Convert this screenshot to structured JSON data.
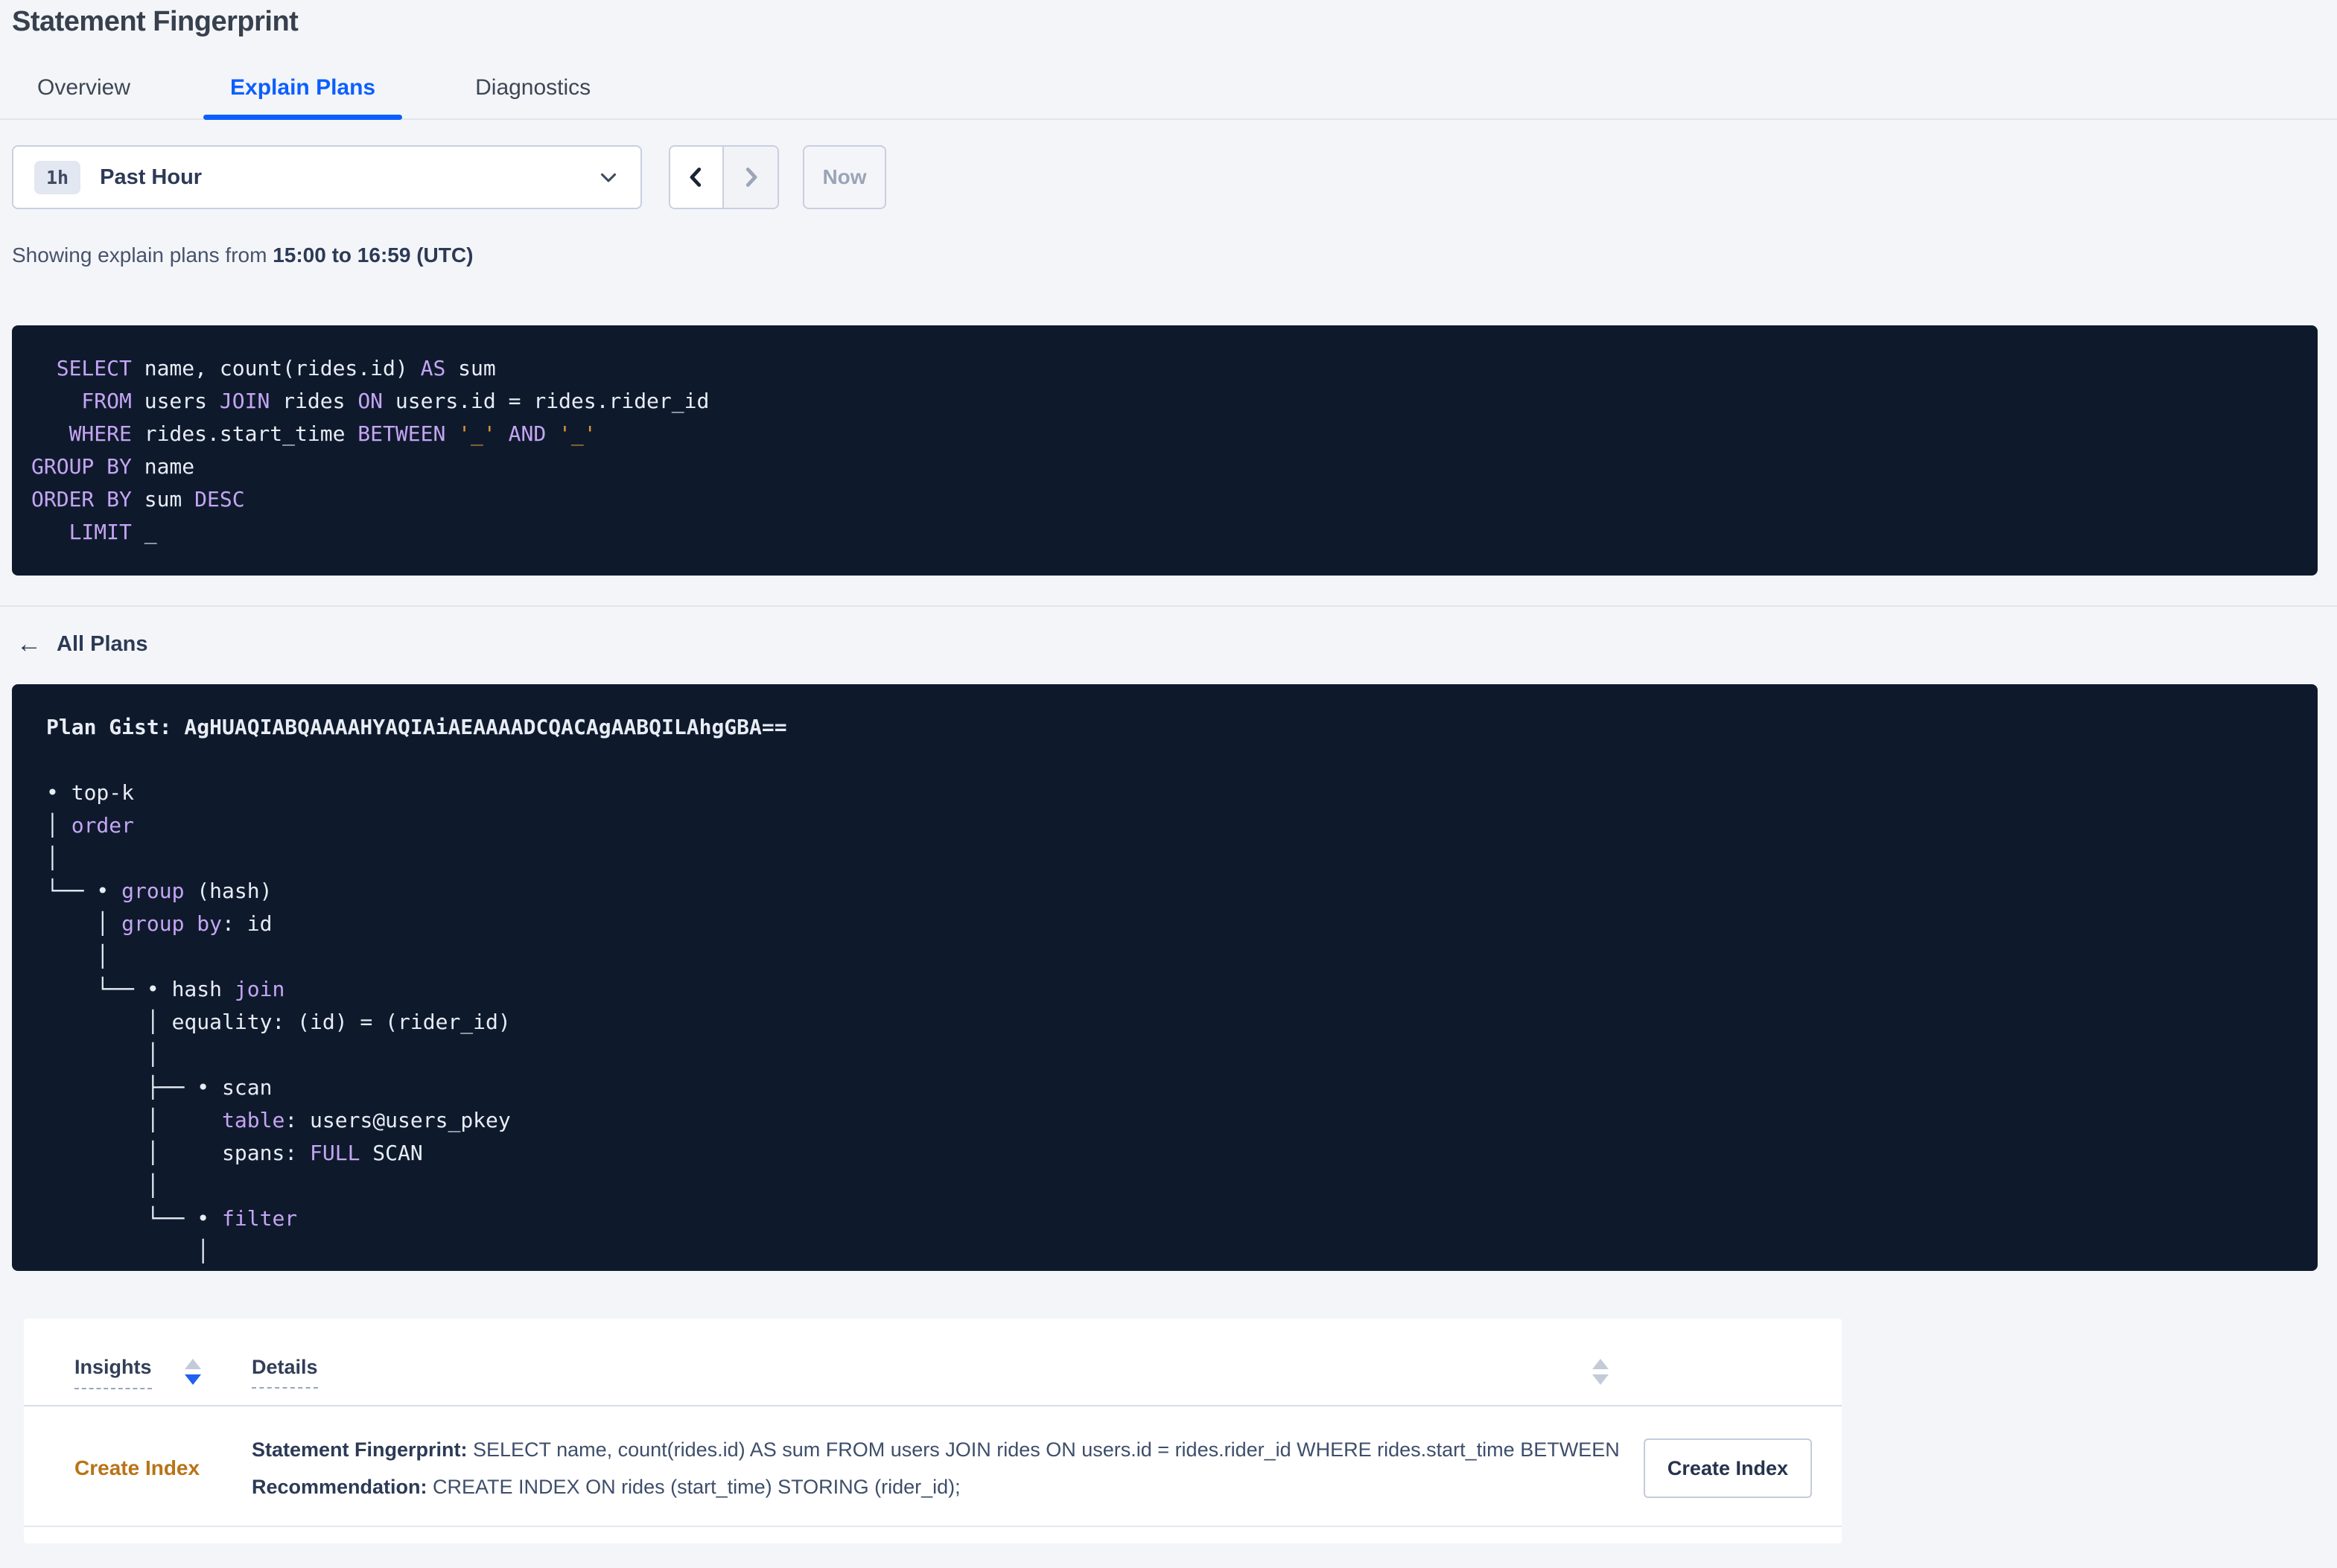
{
  "page": {
    "title": "Statement Fingerprint"
  },
  "tabs": [
    {
      "label": "Overview"
    },
    {
      "label": "Explain Plans"
    },
    {
      "label": "Diagnostics"
    }
  ],
  "active_tab": "Explain Plans",
  "time_picker": {
    "range_badge": "1h",
    "range_label": "Past Hour",
    "now_label": "Now",
    "icons": {
      "open": "chevron-down",
      "prev": "chevron-left",
      "next": "chevron-right"
    }
  },
  "status_line": {
    "prefix": "Showing explain plans from ",
    "range_bold": "15:00 to 16:59 (UTC)"
  },
  "sql": {
    "lines": [
      [
        {
          "t": "  SELECT",
          "c": "k"
        },
        {
          "t": " name, count(rides.id) ",
          "c": "p"
        },
        {
          "t": "AS",
          "c": "k"
        },
        {
          "t": " sum",
          "c": "p"
        }
      ],
      [
        {
          "t": "    FROM",
          "c": "k"
        },
        {
          "t": " users ",
          "c": "p"
        },
        {
          "t": "JOIN",
          "c": "k"
        },
        {
          "t": " rides ",
          "c": "p"
        },
        {
          "t": "ON",
          "c": "k"
        },
        {
          "t": " users.id = rides.rider_id",
          "c": "p"
        }
      ],
      [
        {
          "t": "   WHERE",
          "c": "k"
        },
        {
          "t": " rides.start_time ",
          "c": "p"
        },
        {
          "t": "BETWEEN",
          "c": "k"
        },
        {
          "t": " ",
          "c": "p"
        },
        {
          "t": "'_'",
          "c": "o"
        },
        {
          "t": " ",
          "c": "p"
        },
        {
          "t": "AND",
          "c": "k"
        },
        {
          "t": " ",
          "c": "p"
        },
        {
          "t": "'_'",
          "c": "o"
        }
      ],
      [
        {
          "t": "GROUP BY",
          "c": "k"
        },
        {
          "t": " name",
          "c": "p"
        }
      ],
      [
        {
          "t": "ORDER BY",
          "c": "k"
        },
        {
          "t": " sum ",
          "c": "p"
        },
        {
          "t": "DESC",
          "c": "k"
        }
      ],
      [
        {
          "t": "   LIMIT",
          "c": "k"
        },
        {
          "t": " _",
          "c": "p"
        }
      ]
    ]
  },
  "back_link": {
    "label": "All Plans",
    "icon": "arrow-left"
  },
  "plan": {
    "tree_lines": [
      [
        {
          "t": "Plan Gist: AgHUAQIABQAAAAHYAQIAiAEAAAADCQACAgAABQILAhgGBA==",
          "c": "g"
        }
      ],
      [
        {
          "t": "",
          "c": "p"
        }
      ],
      [
        {
          "t": "• top-k",
          "c": "p"
        }
      ],
      [
        {
          "t": "│ ",
          "c": "p"
        },
        {
          "t": "order",
          "c": "k"
        }
      ],
      [
        {
          "t": "│",
          "c": "p"
        }
      ],
      [
        {
          "t": "└── • ",
          "c": "p"
        },
        {
          "t": "group",
          "c": "k"
        },
        {
          "t": " (hash)",
          "c": "p"
        }
      ],
      [
        {
          "t": "    │ ",
          "c": "p"
        },
        {
          "t": "group by",
          "c": "k"
        },
        {
          "t": ": id",
          "c": "p"
        }
      ],
      [
        {
          "t": "    │",
          "c": "p"
        }
      ],
      [
        {
          "t": "    └── • hash ",
          "c": "p"
        },
        {
          "t": "join",
          "c": "k"
        }
      ],
      [
        {
          "t": "        │ equality: (id) = (rider_id)",
          "c": "p"
        }
      ],
      [
        {
          "t": "        │",
          "c": "p"
        }
      ],
      [
        {
          "t": "        ├── • scan",
          "c": "p"
        }
      ],
      [
        {
          "t": "        │     ",
          "c": "p"
        },
        {
          "t": "table",
          "c": "k"
        },
        {
          "t": ": users@users_pkey",
          "c": "p"
        }
      ],
      [
        {
          "t": "        │     spans: ",
          "c": "p"
        },
        {
          "t": "FULL",
          "c": "k"
        },
        {
          "t": " SCAN",
          "c": "p"
        }
      ],
      [
        {
          "t": "        │",
          "c": "p"
        }
      ],
      [
        {
          "t": "        └── • ",
          "c": "p"
        },
        {
          "t": "filter",
          "c": "k"
        }
      ],
      [
        {
          "t": "            │",
          "c": "p"
        }
      ]
    ]
  },
  "insights_table": {
    "columns": [
      {
        "label": "Insights",
        "sort": "desc"
      },
      {
        "label": "Details",
        "sort": "none"
      }
    ],
    "rows": [
      {
        "insight": "Create Index",
        "fingerprint_label": "Statement Fingerprint:",
        "fingerprint_text": " SELECT name, count(rides.id) AS sum FROM users JOIN rides ON users.id = rides.rider_id WHERE rides.start_time BETWEEN '_…",
        "recommendation_label": "Recommendation:",
        "recommendation_text": " CREATE INDEX ON rides (start_time) STORING (rider_id);",
        "action_label": "Create Index"
      }
    ]
  },
  "colors": {
    "accent_blue": "#0B5FFF",
    "keyword_purple": "#C5A5F3",
    "literal_orange": "#DE9733",
    "insight_orange": "#B97317",
    "code_background": "#0E1A2C",
    "page_background": "#F4F5F9"
  }
}
